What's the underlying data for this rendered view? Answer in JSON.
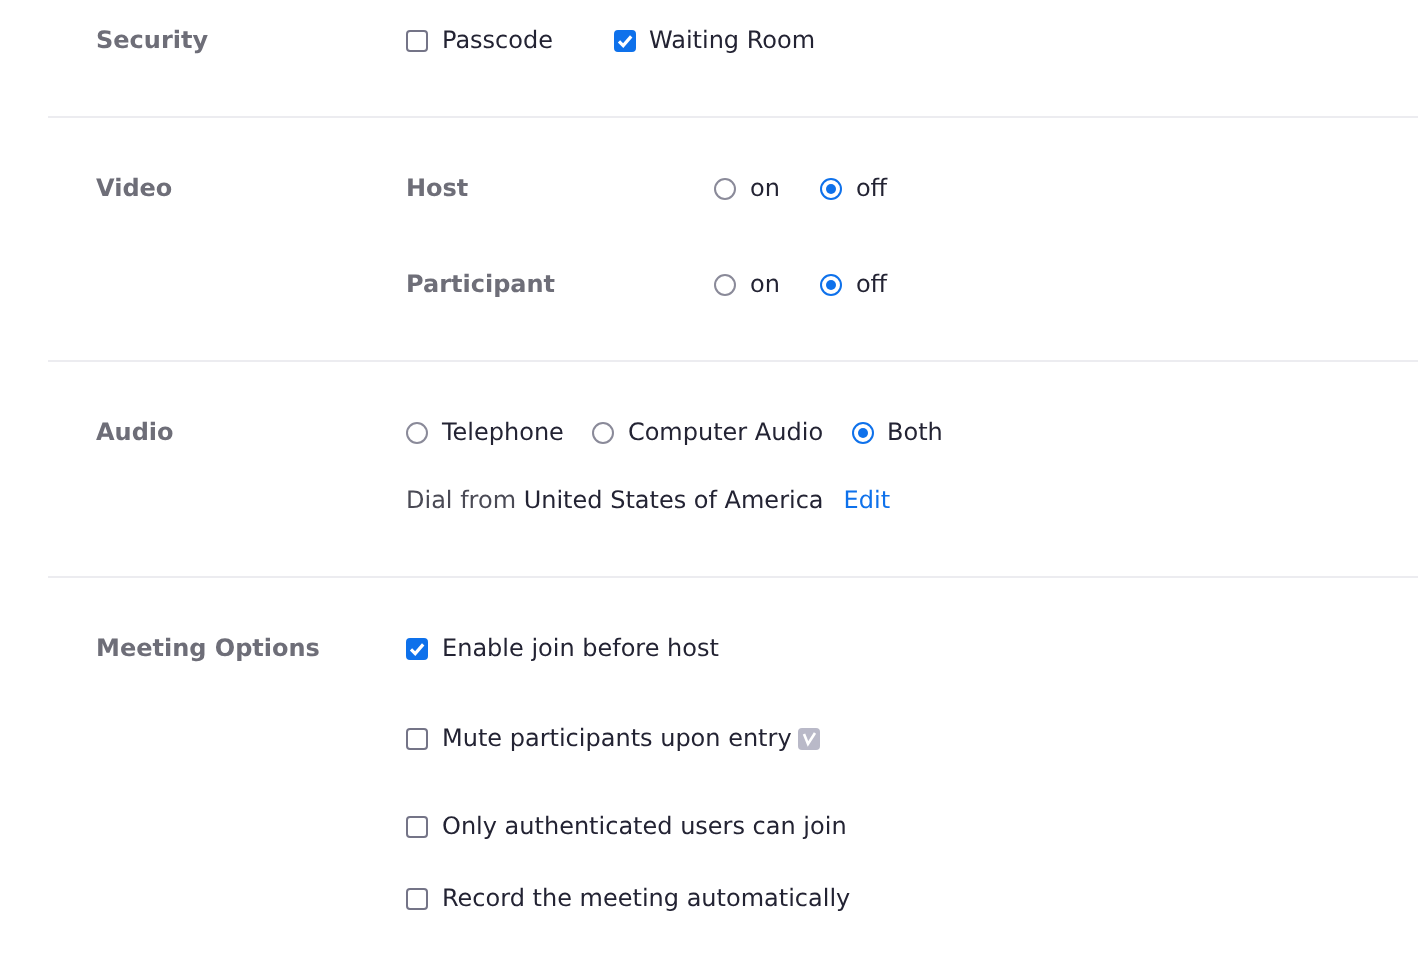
{
  "sections": [
    {
      "kind": "checks",
      "label": "Security",
      "options": [
        {
          "label": "Passcode",
          "checked": false
        },
        {
          "label": "Waiting Room",
          "checked": true
        }
      ]
    },
    {
      "kind": "radio_rows",
      "label": "Video",
      "rows": [
        {
          "label": "Host",
          "options": [
            {
              "label": "on",
              "selected": false
            },
            {
              "label": "off",
              "selected": true
            }
          ]
        },
        {
          "label": "Participant",
          "options": [
            {
              "label": "on",
              "selected": false
            },
            {
              "label": "off",
              "selected": true
            }
          ]
        }
      ]
    },
    {
      "kind": "radios",
      "label": "Audio",
      "options": [
        {
          "label": "Telephone",
          "selected": false
        },
        {
          "label": "Computer Audio",
          "selected": false
        },
        {
          "label": "Both",
          "selected": true
        }
      ],
      "dial": {
        "prefix": "Dial from",
        "country": "United States of America",
        "link": "Edit"
      }
    },
    {
      "kind": "check_list",
      "label": "Meeting Options",
      "items": [
        {
          "label": "Enable join before host",
          "checked": true,
          "badge": false
        },
        {
          "label": "Mute participants upon entry",
          "checked": false,
          "badge": true
        },
        {
          "label": "Only authenticated users can join",
          "checked": false,
          "badge": false
        },
        {
          "label": "Record the meeting automatically",
          "checked": false,
          "badge": false
        }
      ]
    }
  ]
}
